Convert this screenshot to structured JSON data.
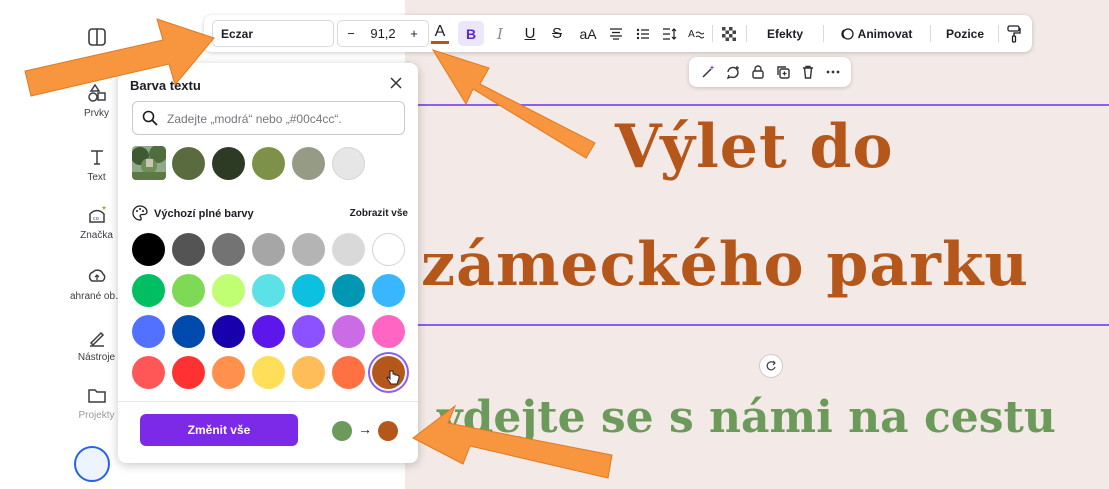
{
  "colors": {
    "accent_purple": "#7d2ae8",
    "selection_purple": "#8b5cf6",
    "canvas_bg": "#f3e9e6",
    "title_brown": "#b5561a",
    "subtitle_green": "#6c9a5b",
    "arrow_orange": "#f7963e"
  },
  "rail": {
    "items": [
      {
        "label": "",
        "icon": "layout-icon"
      },
      {
        "label": "Prvky",
        "icon": "elements-icon"
      },
      {
        "label": "Text",
        "icon": "text-icon"
      },
      {
        "label": "Značka",
        "icon": "brand-icon"
      },
      {
        "label": "ahrané ob…",
        "icon": "uploads-icon"
      },
      {
        "label": "Nástroje",
        "icon": "tools-icon"
      },
      {
        "label": "Projekty",
        "icon": "folder-icon"
      }
    ]
  },
  "toolbar": {
    "font_name": "Eczar",
    "minus": "−",
    "font_size": "91,2",
    "plus": "+",
    "color_letter": "A",
    "bold": "B",
    "italic": "I",
    "underline": "U",
    "strike": "S",
    "case": "aA",
    "effects": "Efekty",
    "animate": "Animovat",
    "position": "Pozice"
  },
  "panel": {
    "title": "Barva textu",
    "search_placeholder": "Zadejte „modrá“ nebo „#00c4cc“.",
    "document_colors": [
      "#5a6b3f",
      "#2d3b24",
      "#7e9148",
      "#969b85",
      "#e6e6e6"
    ],
    "section_title": "Výchozí plné barvy",
    "show_all": "Zobrazit vše",
    "default_colors": [
      [
        "#000000",
        "#545454",
        "#737373",
        "#a6a6a6",
        "#b4b4b4",
        "#d9d9d9",
        "#ffffff"
      ],
      [
        "#00bf63",
        "#7ed957",
        "#c1ff72",
        "#5ce1e6",
        "#0cc0df",
        "#0097b2",
        "#38b6ff"
      ],
      [
        "#5271ff",
        "#004aad",
        "#1800ad",
        "#5e17eb",
        "#8c52ff",
        "#cb6ce6",
        "#ff66c4"
      ],
      [
        "#ff5757",
        "#ff3131",
        "#ff914d",
        "#ffde59",
        "#ffbd59",
        "#ff7043",
        "#b5561a"
      ]
    ],
    "change_all": "Změnit vše",
    "from_color": "#6c9a5b",
    "to_color": "#b5561a",
    "arrow": "→"
  },
  "canvas": {
    "title_line1": "Výlet do",
    "title_line2": "zámeckého parku",
    "subtitle": "ydejte se s námi na cestu"
  }
}
